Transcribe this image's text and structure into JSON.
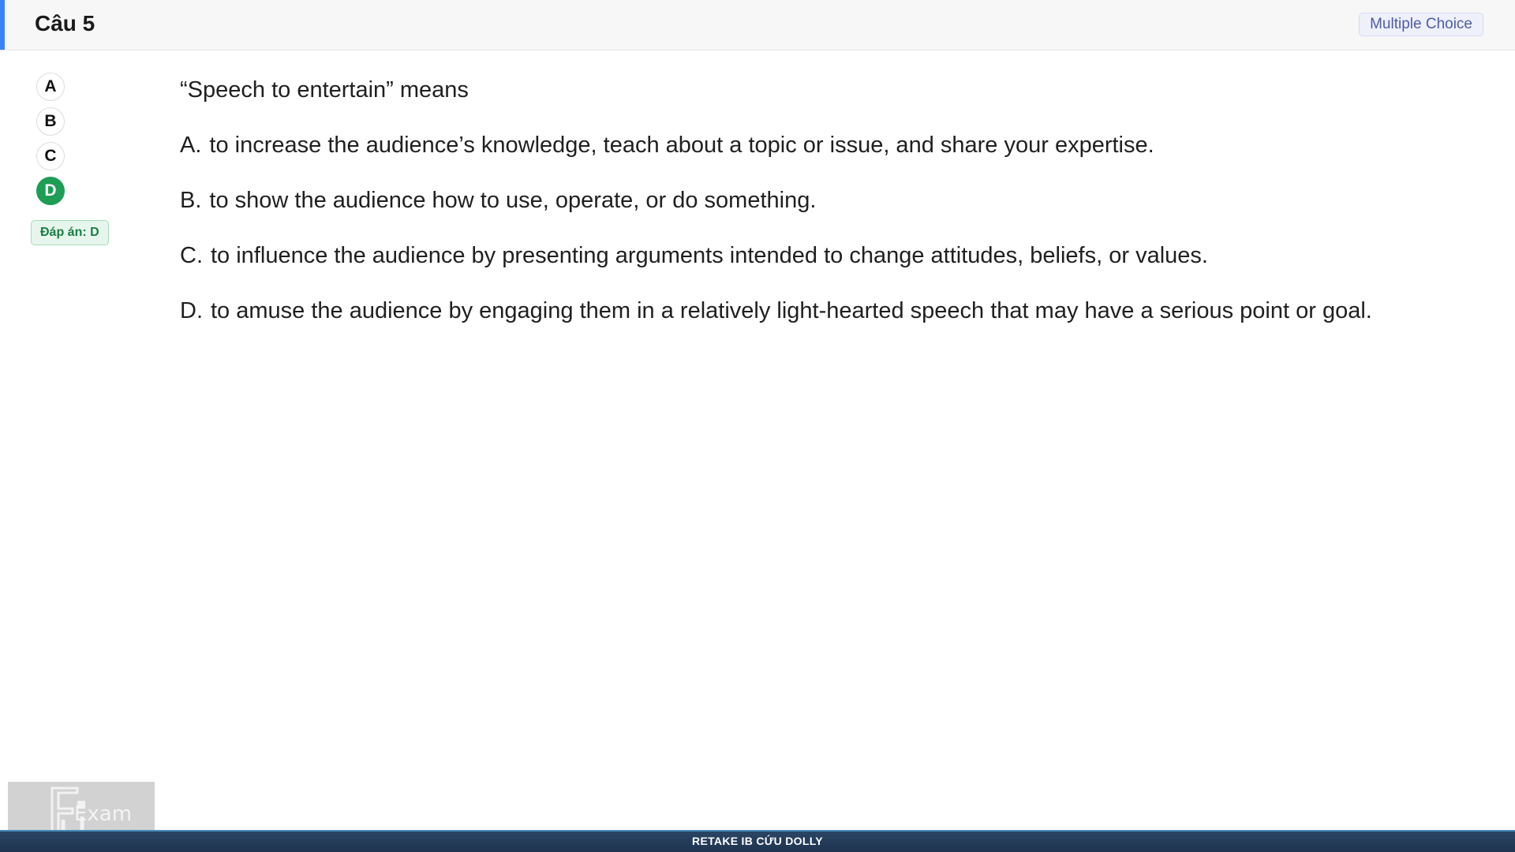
{
  "header": {
    "title": "Câu 5",
    "type_badge": "Multiple Choice",
    "accent_color": "#3b82f6"
  },
  "options": {
    "items": [
      "A",
      "B",
      "C",
      "D"
    ],
    "selected": "D",
    "selected_color": "#1e9d55"
  },
  "answer_badge": "Đáp án: D",
  "question": {
    "stem": "“Speech to entertain” means",
    "choices": [
      {
        "letter": "A.",
        "text": "to increase the audience’s knowledge, teach about a topic or issue, and share your expertise."
      },
      {
        "letter": "B.",
        "text": "to show the audience how to use, operate, or do something."
      },
      {
        "letter": "C.",
        "text": "to influence the audience by presenting arguments intended to change attitudes, beliefs, or values."
      },
      {
        "letter": "D.",
        "text": "to amuse the audience by engaging them in a relatively light-hearted speech that may have a serious point or goal."
      }
    ]
  },
  "logo": {
    "text": "Exam",
    "icon": "fu-logo-icon"
  },
  "footer": {
    "text": "RETAKE IB CỨU DOLLY"
  }
}
